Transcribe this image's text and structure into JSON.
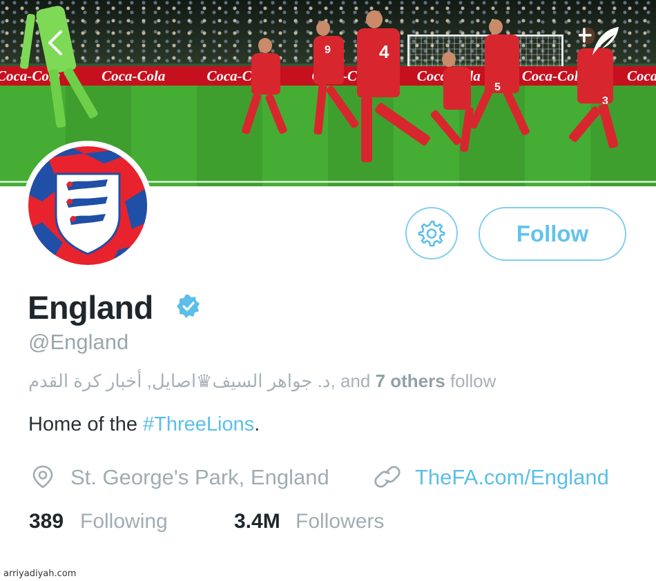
{
  "header": {
    "ad_board_text": "Coca-Cola",
    "jersey_numbers": [
      "4",
      "9",
      "5",
      "3"
    ]
  },
  "profile": {
    "name": "England",
    "handle": "@England",
    "follow_button": "Follow",
    "followed_by": {
      "names": "د. جواهر السيف♛اصايل, أخبار كرة القدم",
      "connector": ", and ",
      "others": "7 others",
      "suffix": " follow"
    },
    "bio": {
      "prefix": "Home of the ",
      "hashtag": "#ThreeLions",
      "suffix": "."
    },
    "location": "St. George's Park, England",
    "website": "TheFA.com/England",
    "stats": {
      "following_count": "389",
      "following_label": "Following",
      "followers_count": "3.4M",
      "followers_label": "Followers"
    }
  },
  "watermark": "arriyadiyah.com",
  "colors": {
    "accent": "#5bbfe9",
    "button_border": "#7fcdef",
    "verified": "#5bbfe9",
    "crest_red": "#e8232d",
    "crest_blue": "#1f4fa6"
  },
  "icons": {
    "back": "chevron-left-icon",
    "compose": "compose-icon",
    "settings": "gear-icon",
    "verified": "verified-badge-icon",
    "location": "location-pin-icon",
    "website": "link-icon"
  }
}
